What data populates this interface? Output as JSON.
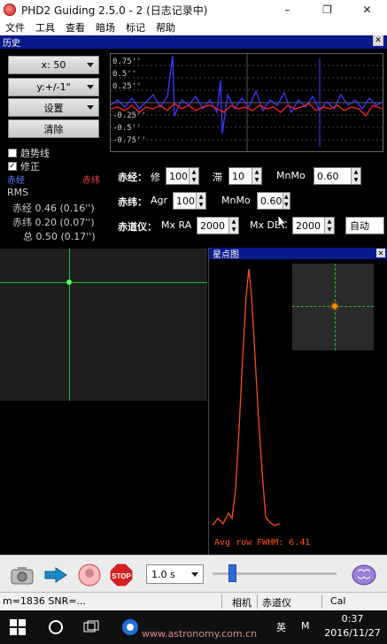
{
  "window": {
    "title": "PHD2 Guiding 2.5.0 - 2 (日志记录中)",
    "minimize": "–",
    "maximize": "❐",
    "close": "✕"
  },
  "menu": [
    "文件",
    "工具",
    "查看",
    "暗场",
    "标记",
    "帮助"
  ],
  "history": {
    "header": "历史",
    "close": "✕",
    "x_scale": "x: 50",
    "y_scale": "y:+/-1\"",
    "settings": "设置",
    "clear": "清除",
    "trendline": "趋势线",
    "correction": "修正",
    "correction_checked": "✓",
    "ra_label": "赤经",
    "dec_label": "赤纬",
    "rms_label": "RMS",
    "rms_ra_label": "赤经",
    "rms_ra": "0.46 (0.16'')",
    "rms_dec_label": "赤纬",
    "rms_dec": "0.20 (0.07'')",
    "rms_tot_label": "总",
    "rms_tot": "0.50 (0.17'')",
    "graph_labels": {
      "p075": "0.75''",
      "p05": "0.5''",
      "p025": "0.25''",
      "n025": "-0.25''",
      "n05": "-0.5''",
      "n075": "-0.75''"
    },
    "colors": {
      "ra": "#3a3aff",
      "dec": "#ff2020",
      "grid": "#555555"
    }
  },
  "guide_params": {
    "ra_row_label": "赤经：",
    "ra_agg_label": "修",
    "ra_agg": "100",
    "ra_hyst_label": "滞",
    "ra_hyst": "10",
    "ra_minmo_label": "MnMo",
    "ra_minmo": "0.60",
    "dec_row_label": "赤纬：",
    "dec_agg_label": "Agr",
    "dec_agg": "100",
    "dec_minmo_label": "MnMo",
    "dec_minmo": "0.60",
    "mount_row_label": "赤道仪：",
    "mx_ra_label": "Mx RA",
    "mx_ra": "2000",
    "mx_dec_label": "Mx DEC",
    "mx_dec": "2000",
    "dec_mode": "自动"
  },
  "star_profile": {
    "header": "星点图",
    "close": "✕",
    "fwhm_text": "Avg row FWHM: 6.41",
    "color": "#ff4a1a"
  },
  "toolbar": {
    "exposure": "1.0 s"
  },
  "status": {
    "text": "m=1836 SNR=...",
    "camera": "相机",
    "mount": "赤道仪",
    "cal": "Cal"
  },
  "taskbar": {
    "ime": "英",
    "ime2": "M",
    "time": "0:37",
    "date": "2016/11/27",
    "watermark": "www.astronomy.com.cn"
  }
}
